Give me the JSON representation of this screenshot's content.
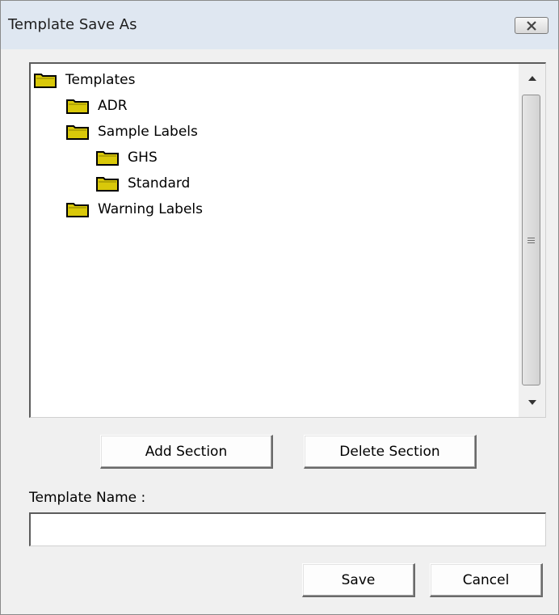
{
  "window": {
    "title": "Template Save As"
  },
  "tree": {
    "items": [
      {
        "label": "Templates",
        "level": 0
      },
      {
        "label": "ADR",
        "level": 1
      },
      {
        "label": "Sample Labels",
        "level": 1
      },
      {
        "label": "GHS",
        "level": 2
      },
      {
        "label": "Standard",
        "level": 2
      },
      {
        "label": "Warning Labels",
        "level": 1
      }
    ]
  },
  "buttons": {
    "add_section": "Add Section",
    "delete_section": "Delete Section",
    "save": "Save",
    "cancel": "Cancel"
  },
  "template_name": {
    "label": "Template Name :",
    "value": ""
  },
  "icons": {
    "folder": "folder-icon",
    "close": "close-icon",
    "scroll_up": "scroll-up-arrow-icon",
    "scroll_down": "scroll-down-arrow-icon"
  },
  "colors": {
    "folder_fill": "#d9c80a",
    "titlebar": "#dfe7f1",
    "dialog_bg": "#f0f0f0"
  }
}
